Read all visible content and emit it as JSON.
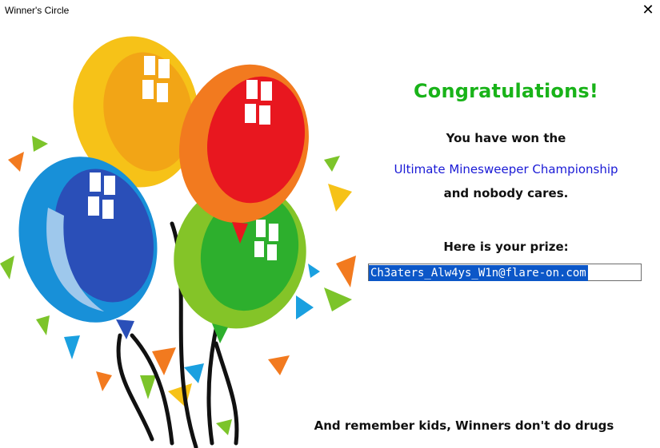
{
  "window": {
    "title": "Winner's Circle",
    "close_glyph": "✕"
  },
  "message": {
    "heading": "Congratulations!",
    "line1": "You have won the",
    "championship": "Ultimate Minesweeper Championship",
    "line3": "and nobody cares.",
    "prize_label": "Here is your prize:",
    "prize_value": "Ch3aters_Alw4ys_W1n@flare-on.com",
    "footer": "And remember kids, Winners don't do drugs"
  },
  "colors": {
    "heading": "#19b319",
    "championship": "#1a1ad6",
    "selection": "#0c57c8"
  },
  "art": {
    "icon": "balloons-and-confetti"
  }
}
